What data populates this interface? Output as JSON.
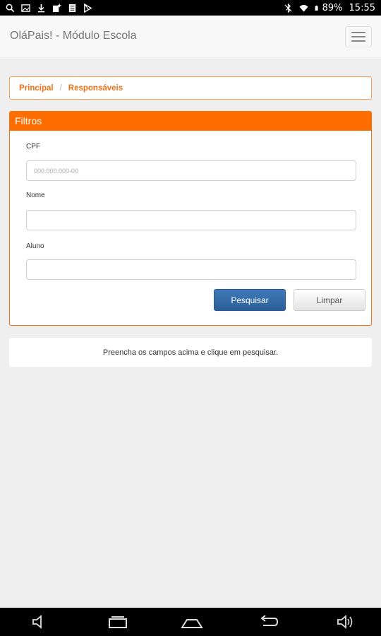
{
  "status_bar": {
    "battery": "89%",
    "time": "15:55"
  },
  "navbar": {
    "brand": "OláPais! - Módulo Escola"
  },
  "breadcrumb": {
    "items": [
      "Principal",
      "Responsáveis"
    ],
    "separator": "/"
  },
  "filters": {
    "title": "Filtros",
    "cpf_label": "CPF",
    "cpf_placeholder": "000.000.000-00",
    "cpf_value": "",
    "nome_label": "Nome",
    "nome_value": "",
    "aluno_label": "Aluno",
    "aluno_value": "",
    "search_label": "Pesquisar",
    "clear_label": "Limpar"
  },
  "info": {
    "message": "Preencha os campos acima e clique em pesquisar."
  },
  "colors": {
    "accent": "#ff6c00",
    "primary_button": "#2c5f99"
  }
}
